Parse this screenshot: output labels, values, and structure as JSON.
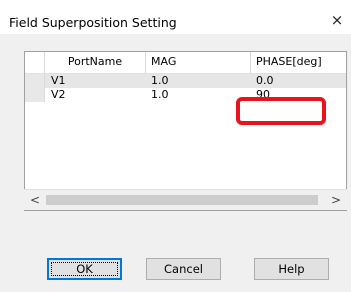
{
  "window": {
    "title": "Field Superposition Setting",
    "close_icon": "×"
  },
  "table": {
    "columns": [
      "PortName",
      "MAG",
      "PHASE[deg]"
    ],
    "rows": [
      {
        "port": "V1",
        "mag": "1.0",
        "phase": "0.0"
      },
      {
        "port": "V2",
        "mag": "1.0",
        "phase": "90"
      }
    ],
    "highlight_color": "#e8131c"
  },
  "scrollbar": {
    "left_icon": "<",
    "right_icon": ">"
  },
  "buttons": {
    "ok": "OK",
    "cancel": "Cancel",
    "help": "Help"
  }
}
